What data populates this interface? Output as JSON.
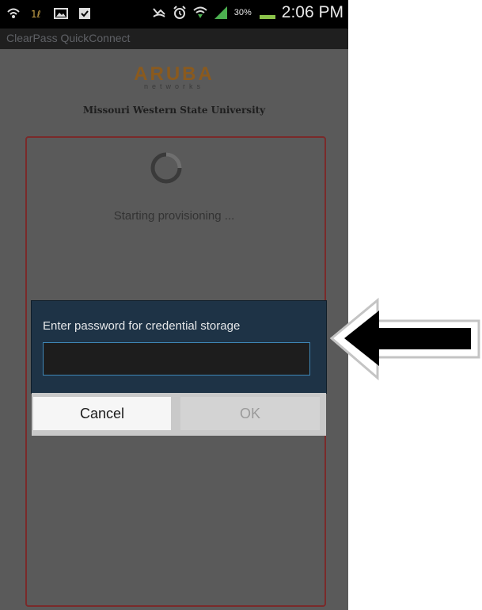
{
  "status_bar": {
    "time": "2:06 PM",
    "battery_percent": "30%",
    "icons": [
      "wifi-icon",
      "app-notification-icon",
      "image-icon",
      "clipboard-check-icon",
      "missed-call-icon",
      "alarm-icon",
      "wifi-signal-icon",
      "cell-signal-icon",
      "battery-icon"
    ]
  },
  "app_bar": {
    "title": "ClearPass QuickConnect"
  },
  "header": {
    "logo_text": "ARUBA",
    "logo_subtext": "networks",
    "university": "Missouri Western State University"
  },
  "progress": {
    "text": "Starting provisioning ..."
  },
  "dialog": {
    "title": "Enter password for credential storage",
    "password_value": "",
    "cancel_label": "Cancel",
    "ok_label": "OK"
  },
  "colors": {
    "dialog_bg": "#1e3346",
    "input_border": "#3f88b8",
    "frame_border": "#7a2a2a",
    "logo": "#8a5a1e"
  }
}
